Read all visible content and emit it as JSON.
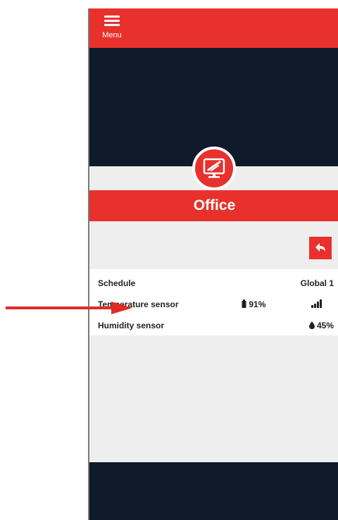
{
  "topbar": {
    "menu_label": "Menu"
  },
  "room": {
    "title": "Office",
    "icon": "monitor-icon"
  },
  "back_button": {
    "icon": "back-arrow-icon"
  },
  "rows": {
    "schedule": {
      "label": "Schedule",
      "value": "Global 1"
    },
    "temperature": {
      "label": "Temperature sensor",
      "battery": "91%",
      "battery_icon": "battery-icon",
      "signal_icon": "signal-icon"
    },
    "humidity": {
      "label": "Humidity sensor",
      "value": "45%",
      "icon": "water-drop-icon"
    }
  },
  "colors": {
    "accent": "#e8312d",
    "dark": "#0f1a2b",
    "light": "#eeeeee"
  }
}
